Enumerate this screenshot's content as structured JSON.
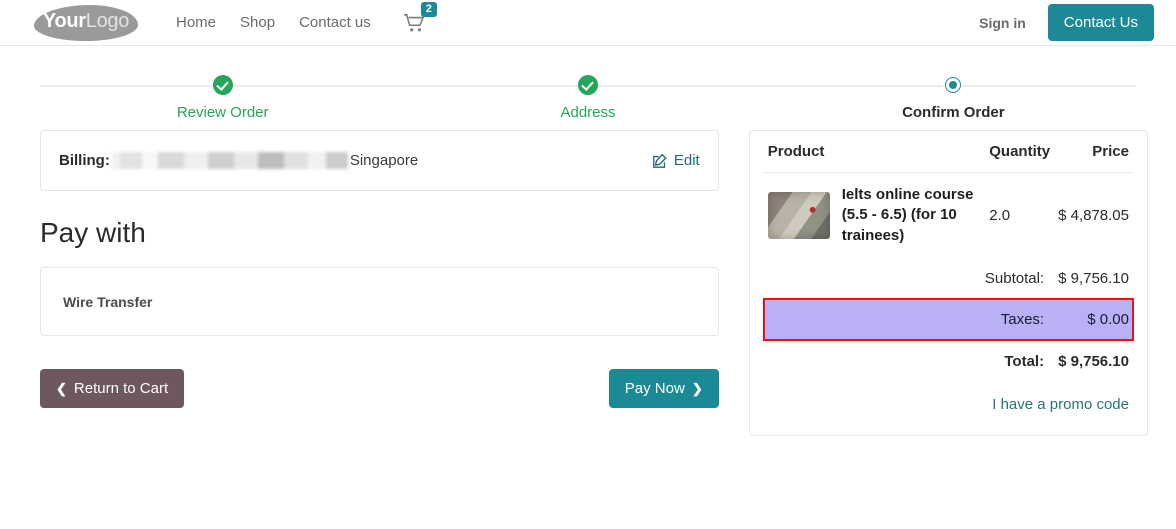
{
  "header": {
    "logo": {
      "part1": "Your",
      "part2": "Logo",
      "icon": "brand-logo"
    },
    "nav": [
      {
        "label": "Home",
        "name": "nav-home"
      },
      {
        "label": "Shop",
        "name": "nav-shop"
      },
      {
        "label": "Contact us",
        "name": "nav-contact-us"
      }
    ],
    "cart": {
      "icon": "shopping-cart-icon",
      "count": "2"
    },
    "sign_in": "Sign in",
    "contact_button": "Contact Us"
  },
  "stepper": {
    "steps": [
      {
        "label": "Review Order",
        "state": "done",
        "icon": "check-circle-icon"
      },
      {
        "label": "Address",
        "state": "done",
        "icon": "check-circle-icon"
      },
      {
        "label": "Confirm Order",
        "state": "current",
        "icon": "current-step-dot-icon"
      }
    ]
  },
  "billing": {
    "label": "Billing:",
    "address_redacted": "",
    "country": "Singapore",
    "edit_label": "Edit",
    "edit_icon": "pencil-square-icon"
  },
  "payment": {
    "title": "Pay with",
    "method": "Wire Transfer"
  },
  "actions": {
    "return_to_cart": "Return to Cart",
    "return_chevron": "❮",
    "pay_now": "Pay Now",
    "pay_chevron": "❯"
  },
  "order_summary": {
    "columns": {
      "product": "Product",
      "quantity": "Quantity",
      "price": "Price"
    },
    "items": [
      {
        "name": "Ielts online course (5.5 - 6.5) (for 10 trainees)",
        "quantity": "2.0",
        "price": "$ 4,878.05",
        "thumbnail": "product-photo"
      }
    ],
    "totals": [
      {
        "label": "Subtotal:",
        "value": "$ 9,756.10",
        "highlight": false,
        "bold": false
      },
      {
        "label": "Taxes:",
        "value": "$ 0.00",
        "highlight": true,
        "bold": false
      },
      {
        "label": "Total:",
        "value": "$ 9,756.10",
        "highlight": false,
        "bold": true
      }
    ],
    "promo_link": "I have a promo code"
  },
  "colors": {
    "brand_teal": "#1b8a96",
    "step_done_green": "#25a65b",
    "return_button": "#6d5761",
    "highlight_fill": "#b9b0f5",
    "highlight_border": "#ee1111",
    "link_teal": "#2d7078"
  }
}
